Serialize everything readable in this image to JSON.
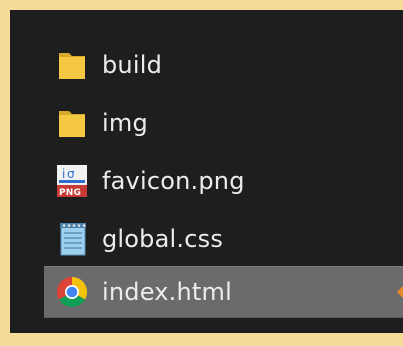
{
  "files": [
    {
      "name": "build",
      "icon": "folder-icon"
    },
    {
      "name": "img",
      "icon": "folder-icon"
    },
    {
      "name": "favicon.png",
      "icon": "png-file-icon"
    },
    {
      "name": "global.css",
      "icon": "notepad-file-icon"
    },
    {
      "name": "index.html",
      "icon": "chrome-icon",
      "selected": true
    }
  ],
  "colors": {
    "background": "#f7dc99",
    "panel": "#1e1e1e",
    "selected_row": "#6b6b6b",
    "text": "#ececec",
    "folder": "#f5c842",
    "status_marker": "#e3892b"
  }
}
